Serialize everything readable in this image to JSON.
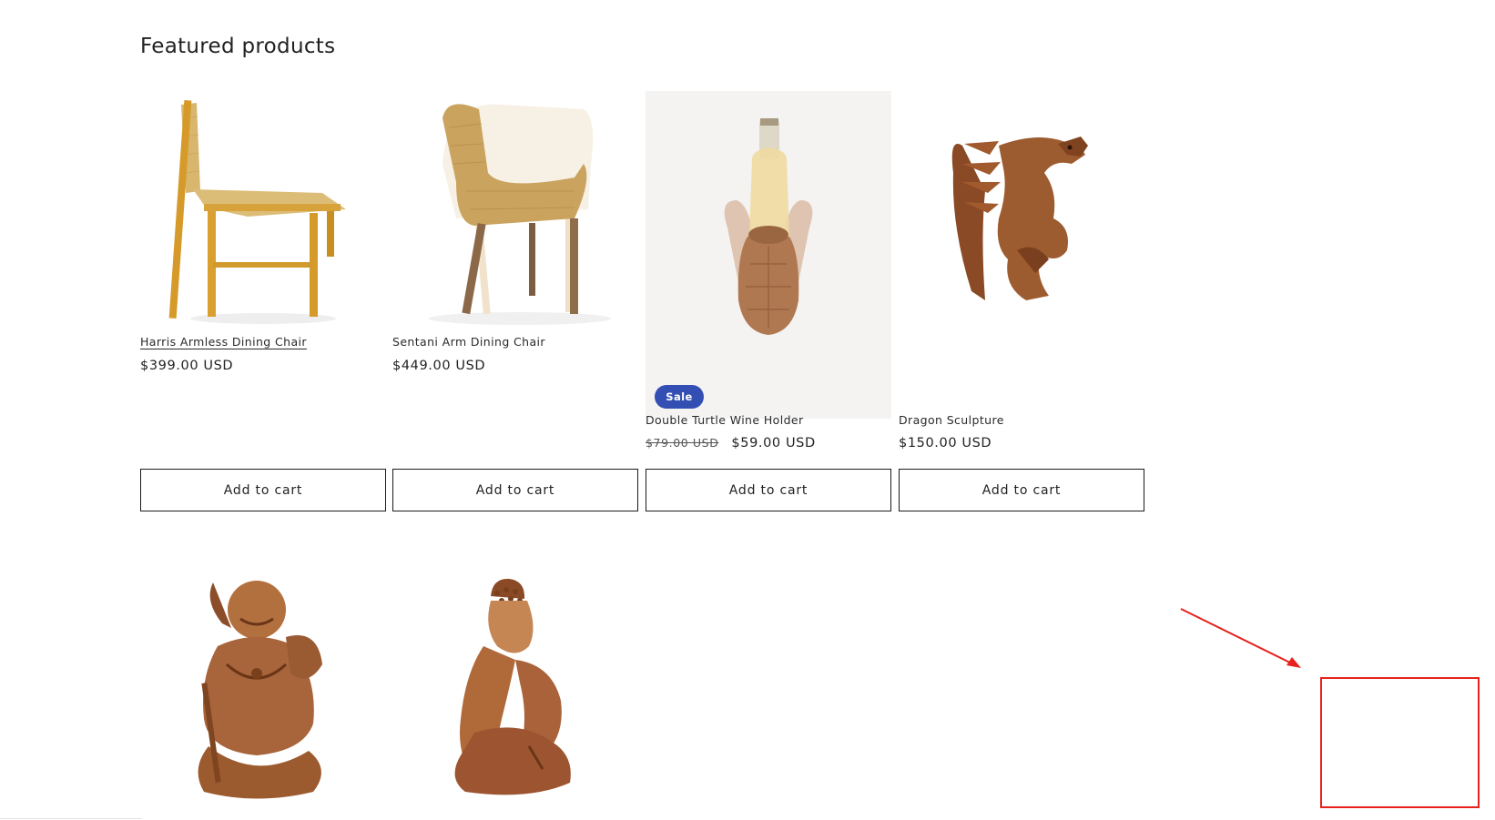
{
  "section": {
    "title": "Featured products"
  },
  "products": [
    {
      "title": "Harris Armless Dining Chair",
      "price": "$399.00 USD",
      "image": "rattan-chair-image",
      "button": "Add to cart"
    },
    {
      "title": "Sentani Arm Dining Chair",
      "price": "$449.00 USD",
      "image": "woven-armchair-image",
      "button": "Add to cart"
    },
    {
      "title": "Double Turtle Wine Holder",
      "compare_price": "$79.00 USD",
      "price": "$59.00 USD",
      "badge": "Sale",
      "image": "turtle-wine-holder-image",
      "button": "Add to cart"
    },
    {
      "title": "Dragon Sculpture",
      "price": "$150.00 USD",
      "image": "dragon-sculpture-image",
      "button": "Add to cart"
    },
    {
      "title": "",
      "image": "laughing-buddha-sculpture-image"
    },
    {
      "title": "",
      "image": "resting-buddha-sculpture-image"
    }
  ],
  "annotation": {
    "color": "#e8211d",
    "shapes": [
      "red-arrow",
      "red-highlight-box"
    ]
  },
  "colors": {
    "sale_badge": "#334fb4",
    "button_border": "#1a1a1a",
    "text": "#121212"
  }
}
